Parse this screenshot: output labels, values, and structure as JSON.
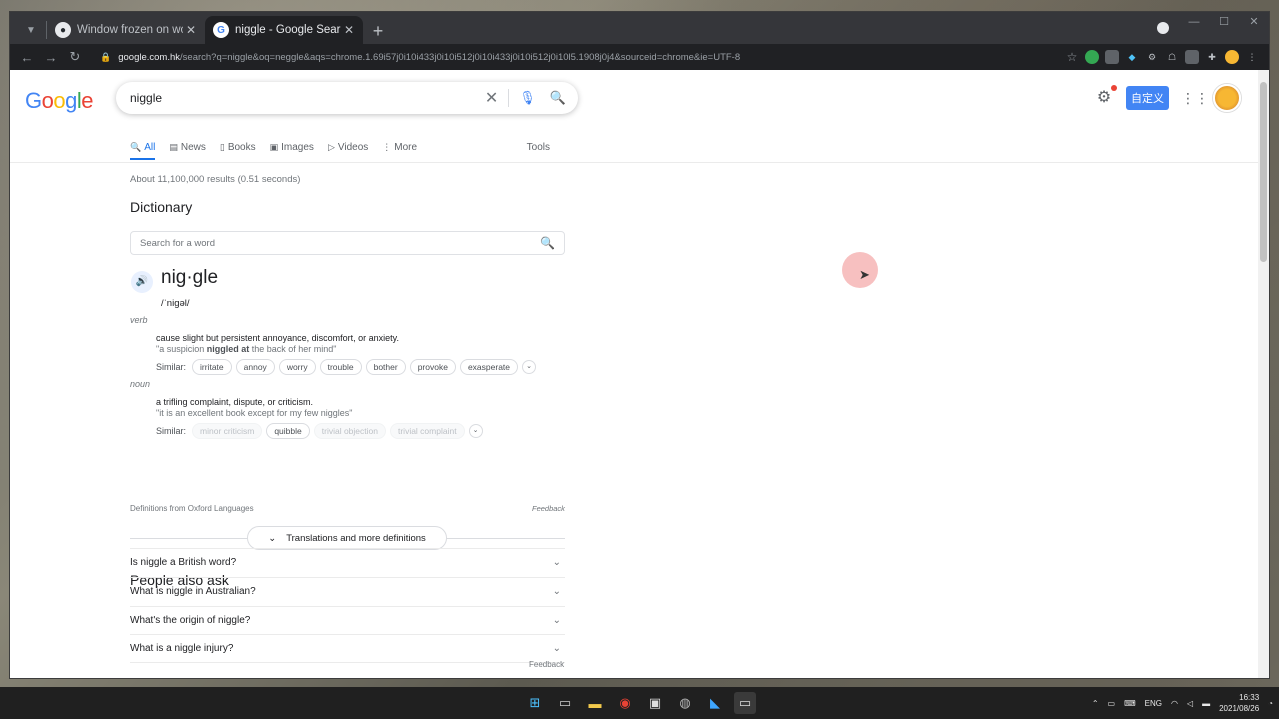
{
  "browser": {
    "tabs": [
      {
        "title": "Window frozen on workspace sw",
        "active": false
      },
      {
        "title": "niggle - Google Search",
        "active": true
      }
    ],
    "url_host": "google.com.hk",
    "url_path": "/search?q=niggle&oq=neggle&aqs=chrome.1.69i57j0i10i433j0i10i512j0i10i433j0i10i512j0i10l5.1908j0j4&sourceid=chrome&ie=UTF-8"
  },
  "search": {
    "query": "niggle",
    "custom_label": "自定义"
  },
  "nav_tabs": [
    {
      "label": "All",
      "icon": "search-icon"
    },
    {
      "label": "News",
      "icon": "news-icon"
    },
    {
      "label": "Books",
      "icon": "book-icon"
    },
    {
      "label": "Images",
      "icon": "image-icon"
    },
    {
      "label": "Videos",
      "icon": "video-icon"
    },
    {
      "label": "More",
      "icon": "more-icon"
    }
  ],
  "tools_label": "Tools",
  "result_stats": "About 11,100,000 results (0.51 seconds)",
  "dictionary": {
    "title": "Dictionary",
    "search_placeholder": "Search for a word",
    "headword": "nig·gle",
    "phonetic": "/ˈniɡəl/",
    "senses": [
      {
        "pos": "verb",
        "definition": "cause slight but persistent annoyance, discomfort, or anxiety.",
        "example_pre": "\"a suspicion ",
        "example_bold": "niggled at",
        "example_post": " the back of her mind\"",
        "similar": [
          "irritate",
          "annoy",
          "worry",
          "trouble",
          "bother",
          "provoke",
          "exasperate"
        ],
        "similar_dim": []
      },
      {
        "pos": "noun",
        "definition": "a trifling complaint, dispute, or criticism.",
        "example_pre": "\"it is an excellent book except for my few niggles\"",
        "example_bold": "",
        "example_post": "",
        "similar": [
          "minor criticism",
          "quibble",
          "trivial objection",
          "trivial complaint"
        ],
        "similar_dim": [
          true,
          false,
          true,
          true
        ]
      }
    ],
    "similar_label": "Similar:",
    "source": "Definitions from Oxford Languages",
    "feedback": "Feedback",
    "translations_label": "Translations and more definitions"
  },
  "people_also_ask": {
    "title": "People also ask",
    "questions": [
      "Is niggle a British word?",
      "What is niggle in Australian?",
      "What's the origin of niggle?",
      "What is a niggle injury?"
    ],
    "feedback": "Feedback"
  },
  "taskbar": {
    "lang": "ENG",
    "time": "16:33",
    "date": "2021/08/26"
  }
}
